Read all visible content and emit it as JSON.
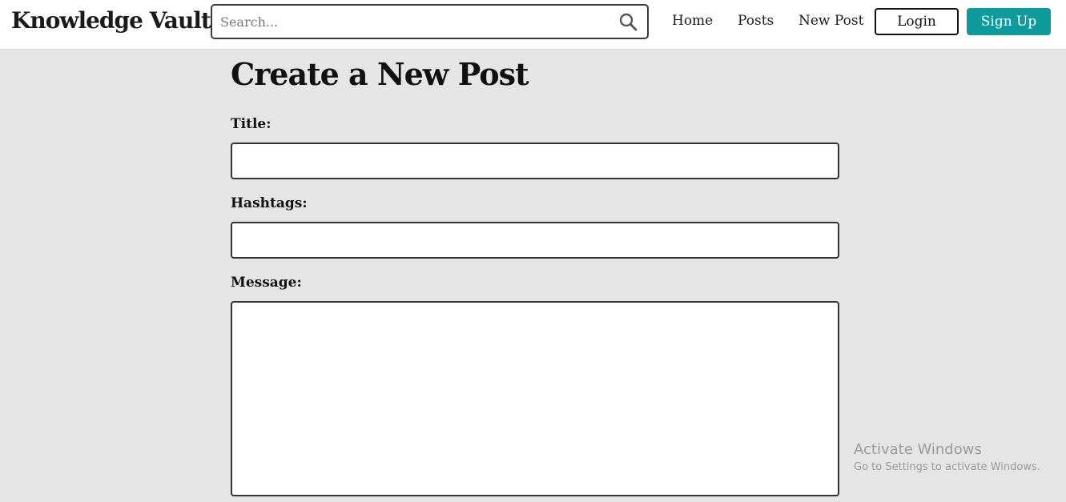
{
  "header": {
    "brand": "Knowledge Vault",
    "search": {
      "placeholder": "Search...",
      "value": "",
      "icon": "search-icon"
    },
    "nav": {
      "home": "Home",
      "posts": "Posts",
      "new_post": "New Post"
    },
    "login_label": "Login",
    "signup_label": "Sign Up"
  },
  "main": {
    "page_title": "Create a New Post",
    "form": {
      "title_label": "Title:",
      "title_value": "",
      "hashtags_label": "Hashtags:",
      "hashtags_value": "",
      "message_label": "Message:",
      "message_value": ""
    }
  },
  "watermark": {
    "title": "Activate Windows",
    "subtitle": "Go to Settings to activate Windows."
  },
  "colors": {
    "page_background": "#e5e5e5",
    "header_background": "#ffffff",
    "accent": "#0f9b9b",
    "text": "#111111"
  }
}
